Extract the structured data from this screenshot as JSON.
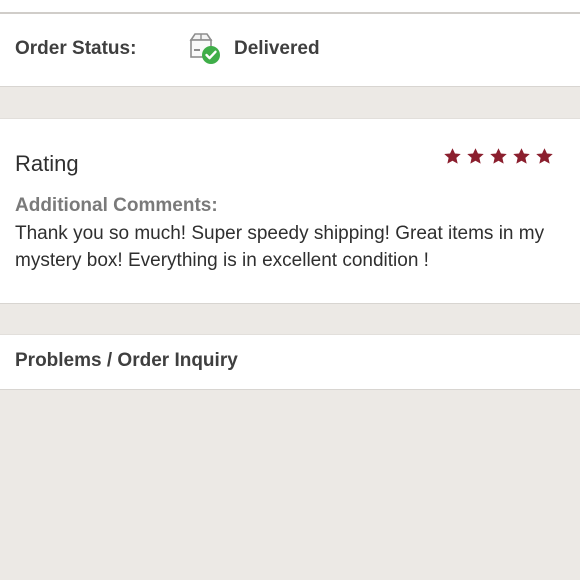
{
  "order_status": {
    "label": "Order Status:",
    "value": "Delivered",
    "icon": "package-delivered-icon",
    "check_color": "#3fae49"
  },
  "rating": {
    "title": "Rating",
    "stars": 5,
    "max_stars": 5,
    "star_color": "#8b1f2e",
    "comments_label": "Additional Comments:",
    "comments_text": "Thank you so much! Super speedy shipping! Great items in my mystery box! Everything is in excellent condition !"
  },
  "problems": {
    "label": "Problems / Order Inquiry"
  },
  "colors": {
    "page_background": "#ece9e5",
    "card_background": "#ffffff"
  }
}
